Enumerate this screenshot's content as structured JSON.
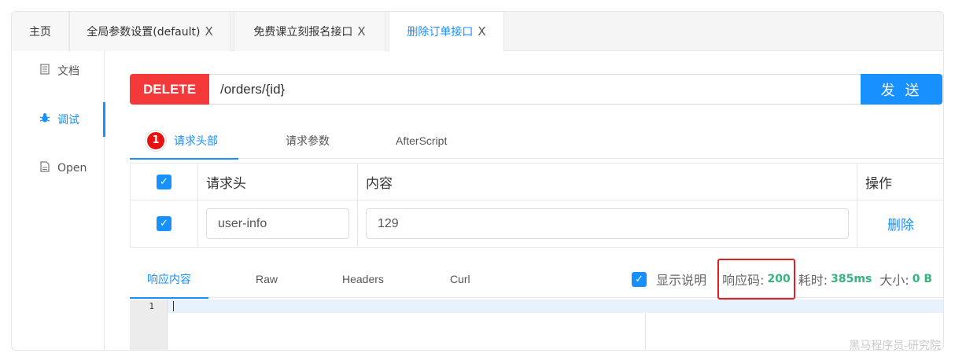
{
  "tabs": [
    {
      "label": "主页",
      "closable": false
    },
    {
      "label": "全局参数设置(default)",
      "closable": true
    },
    {
      "label": "免费课立刻报名接口",
      "closable": true
    },
    {
      "label": "删除订单接口",
      "closable": true,
      "active": true
    }
  ],
  "close_glyph": "X",
  "sidebar": {
    "items": [
      {
        "label": "文档",
        "icon": "document-icon"
      },
      {
        "label": "调试",
        "icon": "bug-icon",
        "active": true
      },
      {
        "label": "Open",
        "icon": "file-icon"
      }
    ]
  },
  "request": {
    "method": "DELETE",
    "method_color": "#f5393b",
    "url": "/orders/{id}",
    "send_label": "发 送"
  },
  "request_tabs": {
    "badge": "1",
    "items": [
      "请求头部",
      "请求参数",
      "AfterScript"
    ]
  },
  "headers_table": {
    "columns": [
      "请求头",
      "内容",
      "操作"
    ],
    "rows": [
      {
        "checked": true,
        "key": "user-info",
        "value": "129",
        "action": "删除"
      }
    ]
  },
  "response": {
    "tabs": [
      "响应内容",
      "Raw",
      "Headers",
      "Curl"
    ],
    "show_desc_label": "显示说明",
    "status_label": "响应码:",
    "status_value": "200",
    "time_label": "耗时:",
    "time_value": "385ms",
    "size_label": "大小:",
    "size_value": "0 B"
  },
  "editor": {
    "line_number": "1"
  },
  "watermark": "黑马程序员-研究院",
  "colors": {
    "accent": "#1890ff",
    "success": "#36b37e",
    "highlight_border": "#e02020"
  }
}
